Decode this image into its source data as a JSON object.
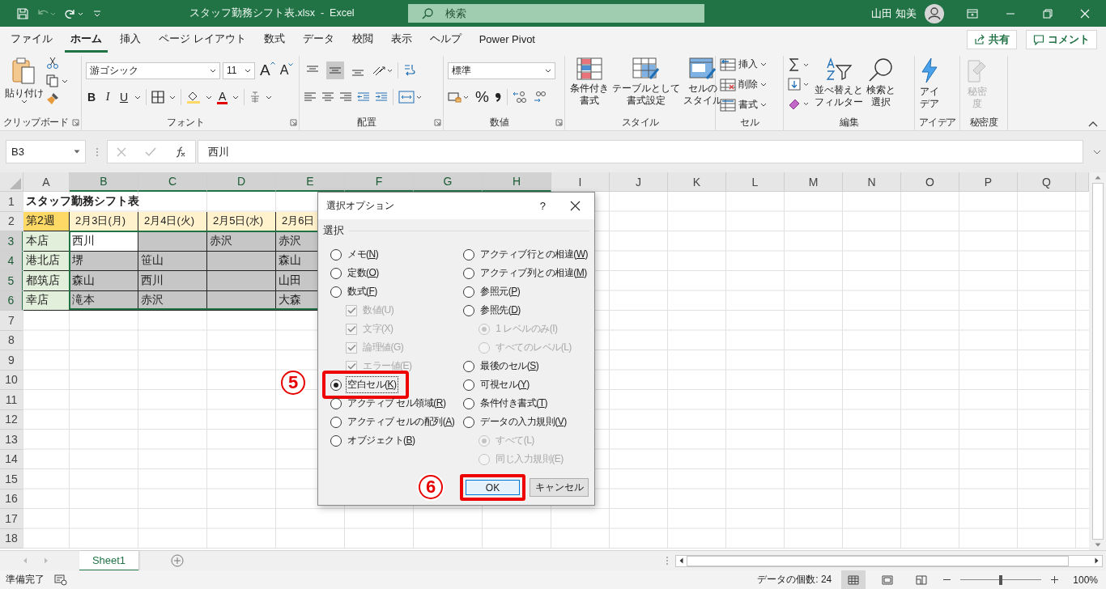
{
  "title_bar": {
    "document": "スタッフ勤務シフト表.xlsx  -  Excel",
    "search": {
      "placeholder": "検索"
    },
    "user": "山田 知美"
  },
  "tabs": [
    {
      "label": "ファイル",
      "selected": false
    },
    {
      "label": "ホーム",
      "selected": true
    },
    {
      "label": "挿入",
      "selected": false
    },
    {
      "label": "ページ レイアウト",
      "selected": false
    },
    {
      "label": "数式",
      "selected": false
    },
    {
      "label": "データ",
      "selected": false
    },
    {
      "label": "校閲",
      "selected": false
    },
    {
      "label": "表示",
      "selected": false
    },
    {
      "label": "ヘルプ",
      "selected": false
    },
    {
      "label": "Power Pivot",
      "selected": false
    }
  ],
  "share": "共有",
  "comment": "コメント",
  "ribbon": [
    {
      "kind": "clipboard",
      "label": "クリップボード",
      "launcher": true,
      "paste": "貼り付け"
    },
    {
      "kind": "font",
      "label": "フォント",
      "launcher": true,
      "font": "游ゴシック",
      "size": "11",
      "grow": "A",
      "shrink": "A",
      "bold": "B",
      "italic": "I",
      "underline": "U",
      "color_glyph": "A"
    },
    {
      "kind": "alignment",
      "label": "配置",
      "launcher": true,
      "vertical": [
        {
          "selected": false
        },
        {
          "selected": true
        },
        {
          "selected": false
        }
      ]
    },
    {
      "kind": "number",
      "label": "数値",
      "launcher": true,
      "format": "標準",
      "percent": "%"
    },
    {
      "kind": "styles",
      "label": "スタイル",
      "launcher": false,
      "buttons": [
        {
          "lines": [
            "条件付き",
            "書式"
          ]
        },
        {
          "lines": [
            "テーブルとして",
            "書式設定"
          ]
        },
        {
          "lines": [
            "セルの",
            "スタイル"
          ]
        }
      ]
    },
    {
      "kind": "cells",
      "label": "セル",
      "launcher": false,
      "buttons": [
        {
          "lines": [
            "挿入"
          ]
        },
        {
          "lines": [
            "削除"
          ]
        },
        {
          "lines": [
            "書式"
          ]
        }
      ]
    },
    {
      "kind": "editing",
      "label": "編集",
      "launcher": false,
      "buttons": [
        {
          "lines": [
            "並べ替えと",
            "フィルター"
          ]
        },
        {
          "lines": [
            "検索と",
            "選択"
          ]
        }
      ]
    },
    {
      "kind": "ideas",
      "label": "アイデア",
      "launcher": false,
      "buttons": [
        {
          "lines": [
            "アイ",
            "デア"
          ],
          "disabled": false
        }
      ]
    },
    {
      "kind": "sensitivity",
      "label": "秘密度",
      "launcher": false,
      "buttons": [
        {
          "lines": [
            "秘密",
            "度"
          ],
          "disabled": true
        }
      ]
    }
  ],
  "formula_bar": {
    "name_box": "B3",
    "formula": "西川"
  },
  "sheet": {
    "columns": [
      {
        "label": "A",
        "selected": false
      },
      {
        "label": "B",
        "selected": true
      },
      {
        "label": "C",
        "selected": true
      },
      {
        "label": "D",
        "selected": true
      },
      {
        "label": "E",
        "selected": true
      },
      {
        "label": "F",
        "selected": true
      },
      {
        "label": "G",
        "selected": true
      },
      {
        "label": "H",
        "selected": true
      },
      {
        "label": "I",
        "selected": false
      },
      {
        "label": "J",
        "selected": false
      },
      {
        "label": "K",
        "selected": false
      },
      {
        "label": "L",
        "selected": false
      },
      {
        "label": "M",
        "selected": false
      },
      {
        "label": "N",
        "selected": false
      },
      {
        "label": "O",
        "selected": false
      },
      {
        "label": "P",
        "selected": false
      },
      {
        "label": "Q",
        "selected": false
      }
    ],
    "rows": [
      {
        "number": "1",
        "selected": false,
        "cells": [
          {
            "text": "スタッフ勤務シフト表",
            "kind": "title",
            "selected": false
          }
        ]
      },
      {
        "number": "2",
        "selected": false,
        "cells": [
          {
            "text": "第2週",
            "kind": "week",
            "selected": false
          },
          {
            "text": "2月3日(月)",
            "kind": "date",
            "selected": false
          },
          {
            "text": "2月4日(火)",
            "kind": "date",
            "selected": false
          },
          {
            "text": "2月5日(水)",
            "kind": "date",
            "selected": false
          },
          {
            "text": "2月6日",
            "kind": "date",
            "selected": false
          }
        ]
      },
      {
        "number": "3",
        "selected": true,
        "cells": [
          {
            "text": "本店",
            "kind": "store",
            "selected": false
          },
          {
            "text": "西川",
            "kind": "name",
            "selected": false
          },
          {
            "kind": "name",
            "selected": true
          },
          {
            "text": "赤沢",
            "kind": "name",
            "selected": true
          },
          {
            "text": "赤沢",
            "kind": "name",
            "selected": true
          }
        ]
      },
      {
        "number": "4",
        "selected": true,
        "cells": [
          {
            "text": "港北店",
            "kind": "store",
            "selected": false
          },
          {
            "text": "堺",
            "kind": "name",
            "selected": true
          },
          {
            "text": "笹山",
            "kind": "name",
            "selected": true
          },
          {
            "kind": "name",
            "selected": true
          },
          {
            "text": "森山",
            "kind": "name",
            "selected": true
          }
        ]
      },
      {
        "number": "5",
        "selected": true,
        "cells": [
          {
            "text": "都筑店",
            "kind": "store",
            "selected": false
          },
          {
            "text": "森山",
            "kind": "name",
            "selected": true
          },
          {
            "text": "西川",
            "kind": "name",
            "selected": true
          },
          {
            "kind": "name",
            "selected": true
          },
          {
            "text": "山田",
            "kind": "name",
            "selected": true
          }
        ]
      },
      {
        "number": "6",
        "selected": true,
        "cells": [
          {
            "text": "幸店",
            "kind": "store",
            "selected": false
          },
          {
            "text": "滝本",
            "kind": "name",
            "selected": true
          },
          {
            "text": "赤沢",
            "kind": "name",
            "selected": true
          },
          {
            "kind": "name",
            "selected": true
          },
          {
            "text": "大森",
            "kind": "name",
            "selected": true
          }
        ]
      },
      {
        "number": "7",
        "selected": false
      },
      {
        "number": "8",
        "selected": false
      },
      {
        "number": "9",
        "selected": false
      },
      {
        "number": "10",
        "selected": false
      },
      {
        "number": "11",
        "selected": false
      },
      {
        "number": "12",
        "selected": false
      },
      {
        "number": "13",
        "selected": false
      },
      {
        "number": "14",
        "selected": false
      },
      {
        "number": "15",
        "selected": false
      },
      {
        "number": "16",
        "selected": false
      },
      {
        "number": "17",
        "selected": false
      },
      {
        "number": "18",
        "selected": false
      }
    ]
  },
  "dialog": {
    "title": "選択オプション",
    "help": "?",
    "group": "選択",
    "left": [
      {
        "kind": "radio",
        "parts": [
          "メモ(",
          "N",
          ")"
        ],
        "selected": false,
        "disabled": false,
        "highlighted": false
      },
      {
        "kind": "radio",
        "parts": [
          "定数(",
          "O",
          ")"
        ],
        "selected": false,
        "disabled": false,
        "highlighted": false
      },
      {
        "kind": "radio",
        "parts": [
          "数式(",
          "F",
          ")"
        ],
        "selected": false,
        "disabled": false,
        "highlighted": false,
        "children": [
          {
            "kind": "check",
            "parts": [
              "数値(U)"
            ],
            "checked": true,
            "disabled": true
          },
          {
            "kind": "check",
            "parts": [
              "文字(X)"
            ],
            "checked": true,
            "disabled": true
          },
          {
            "kind": "check",
            "parts": [
              "論理値(G)"
            ],
            "checked": true,
            "disabled": true
          },
          {
            "kind": "check",
            "parts": [
              "エラー値(E)"
            ],
            "checked": true,
            "disabled": true
          }
        ]
      },
      {
        "kind": "radio",
        "parts": [
          "空白セル(",
          "K",
          ")"
        ],
        "selected": true,
        "disabled": false,
        "highlighted": true
      },
      {
        "kind": "radio",
        "parts": [
          "アクティブ セル領域(",
          "R",
          ")"
        ],
        "selected": false,
        "disabled": false,
        "highlighted": false
      },
      {
        "kind": "radio",
        "parts": [
          "アクティブ セルの配列(",
          "A",
          ")"
        ],
        "selected": false,
        "disabled": false,
        "highlighted": false
      },
      {
        "kind": "radio",
        "parts": [
          "オブジェクト(",
          "B",
          ")"
        ],
        "selected": false,
        "disabled": false,
        "highlighted": false
      }
    ],
    "right": [
      {
        "kind": "radio",
        "parts": [
          "アクティブ行との相違(",
          "W",
          ")"
        ],
        "selected": false,
        "disabled": false,
        "highlighted": false
      },
      {
        "kind": "radio",
        "parts": [
          "アクティブ列との相違(",
          "M",
          ")"
        ],
        "selected": false,
        "disabled": false,
        "highlighted": false
      },
      {
        "kind": "radio",
        "parts": [
          "参照元(",
          "P",
          ")"
        ],
        "selected": false,
        "disabled": false,
        "highlighted": false
      },
      {
        "kind": "radio",
        "parts": [
          "参照先(",
          "D",
          ")"
        ],
        "selected": false,
        "disabled": false,
        "highlighted": false,
        "children": [
          {
            "kind": "radio",
            "parts": [
              "1 レベルのみ(I)"
            ],
            "selected": true,
            "disabled": true
          },
          {
            "kind": "radio",
            "parts": [
              "すべてのレベル(L)"
            ],
            "selected": false,
            "disabled": true
          }
        ]
      },
      {
        "kind": "radio",
        "parts": [
          "最後のセル(",
          "S",
          ")"
        ],
        "selected": false,
        "disabled": false,
        "highlighted": false
      },
      {
        "kind": "radio",
        "parts": [
          "可視セル(",
          "Y",
          ")"
        ],
        "selected": false,
        "disabled": false,
        "highlighted": false
      },
      {
        "kind": "radio",
        "parts": [
          "条件付き書式(",
          "T",
          ")"
        ],
        "selected": false,
        "disabled": false,
        "highlighted": false
      },
      {
        "kind": "radio",
        "parts": [
          "データの入力規則(",
          "V",
          ")"
        ],
        "selected": false,
        "disabled": false,
        "highlighted": false,
        "children": [
          {
            "kind": "radio",
            "parts": [
              "すべて(L)"
            ],
            "selected": true,
            "disabled": true
          },
          {
            "kind": "radio",
            "parts": [
              "同じ入力規則(E)"
            ],
            "selected": false,
            "disabled": true
          }
        ]
      }
    ],
    "buttons": [
      {
        "label": "OK",
        "default": true,
        "highlighted": true
      },
      {
        "label": "キャンセル",
        "default": false,
        "highlighted": false
      }
    ]
  },
  "callouts": [
    {
      "number": "5"
    },
    {
      "number": "6"
    }
  ],
  "sheet_tabs": [
    {
      "label": "Sheet1",
      "selected": true
    }
  ],
  "status_bar": {
    "ready": "準備完了",
    "count": "データの個数: 24",
    "views": [
      {
        "selected": true
      },
      {
        "selected": false
      },
      {
        "selected": false
      }
    ],
    "zoom": {
      "level": 0.5,
      "reading": "100%"
    }
  }
}
